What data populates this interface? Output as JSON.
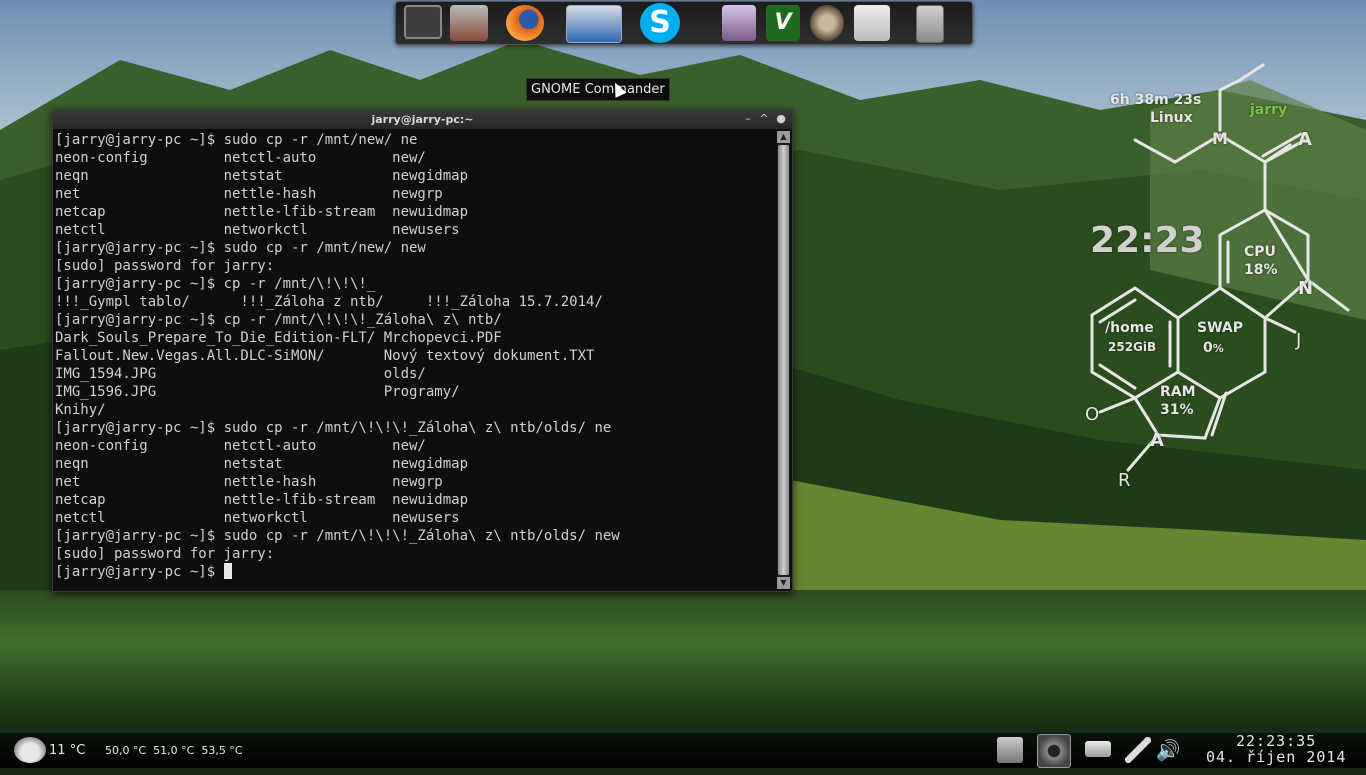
{
  "dock": {
    "items": [
      {
        "name": "monitor",
        "color": "#444"
      },
      {
        "name": "network-tools",
        "color": "#8a4a3a"
      },
      {
        "name": "firefox",
        "color": "#e0621d"
      },
      {
        "name": "gnome-commander",
        "color": "#2f66b0"
      },
      {
        "name": "skype",
        "color": "#00aff0"
      },
      {
        "name": "image-viewer",
        "color": "#7a5a8a"
      },
      {
        "name": "vim",
        "color": "#2e8b2e"
      },
      {
        "name": "gimp",
        "color": "#7a6a4a"
      },
      {
        "name": "mail-clock",
        "color": "#cfcfcf"
      },
      {
        "name": "text-file",
        "color": "#aaaaaa"
      }
    ],
    "tooltip": "GNOME Commander"
  },
  "terminal": {
    "title": "jarry@jarry-pc:~",
    "lines": [
      "[jarry@jarry-pc ~]$ sudo cp -r /mnt/new/ ne",
      "neon-config         netctl-auto         new/",
      "neqn                netstat             newgidmap",
      "net                 nettle-hash         newgrp",
      "netcap              nettle-lfib-stream  newuidmap",
      "netctl              networkctl          newusers",
      "[jarry@jarry-pc ~]$ sudo cp -r /mnt/new/ new",
      "[sudo] password for jarry:",
      "[jarry@jarry-pc ~]$ cp -r /mnt/\\!\\!\\!_",
      "!!!_Gympl tablo/      !!!_Záloha z ntb/     !!!_Záloha 15.7.2014/",
      "[jarry@jarry-pc ~]$ cp -r /mnt/\\!\\!\\!_Záloha\\ z\\ ntb/",
      "Dark_Souls_Prepare_To_Die_Edition-FLT/ Mrchopevci.PDF",
      "Fallout.New.Vegas.All.DLC-SiMON/       Nový textový dokument.TXT",
      "IMG_1594.JPG                           olds/",
      "IMG_1596.JPG                           Programy/",
      "Knihy/",
      "[jarry@jarry-pc ~]$ sudo cp -r /mnt/\\!\\!\\!_Záloha\\ z\\ ntb/olds/ ne",
      "neon-config         netctl-auto         new/",
      "neqn                netstat             newgidmap",
      "net                 nettle-hash         newgrp",
      "netcap              nettle-lfib-stream  newuidmap",
      "netctl              networkctl          newusers",
      "[jarry@jarry-pc ~]$ sudo cp -r /mnt/\\!\\!\\!_Záloha\\ z\\ ntb/olds/ new",
      "[sudo] password for jarry:"
    ],
    "prompt": "[jarry@jarry-pc ~]$ "
  },
  "conky": {
    "uptime": "6h 38m 23s",
    "os": "Linux",
    "user": "jarry",
    "clock": "22:23",
    "cpu_label": "CPU",
    "cpu_value": "18%",
    "home_label": "/home",
    "home_value": "252GiB",
    "swap_label": "SWAP",
    "swap_value": "0",
    "swap_unit": "%",
    "ram_label": "RAM",
    "ram_value": "31%",
    "letters": {
      "m": "M",
      "a_top": "A",
      "n": "N",
      "j": "J",
      "o": "O",
      "a_bottom": "A",
      "r": "R"
    }
  },
  "panel": {
    "weather_temp": "11",
    "weather_unit": "°C",
    "sensors": "50,0 °C  51,0 °C  53,5 °C",
    "time": "22:23:35",
    "date": "04. říjen 2014"
  }
}
